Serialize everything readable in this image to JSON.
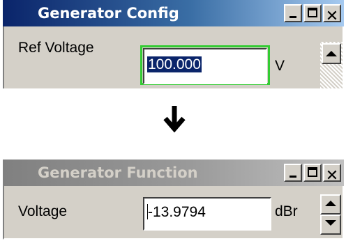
{
  "window_top": {
    "title": "Generator Config",
    "field_label": "Ref Voltage",
    "field_value": "100.000",
    "unit": "V"
  },
  "window_bottom": {
    "title": "Generator Function",
    "field_label": "Voltage",
    "field_value": "-13.9794",
    "unit": "dBr"
  },
  "colors": {
    "active_title": "#0a246a",
    "inactive_title": "#808080",
    "face": "#d4d0c8",
    "selection": "#0a246a",
    "focus_border": "#33cc33"
  },
  "icons": [
    "minimize-icon",
    "maximize-icon",
    "close-icon",
    "down-arrow-icon",
    "spin-up-icon",
    "spin-down-icon",
    "scroll-up-icon"
  ]
}
